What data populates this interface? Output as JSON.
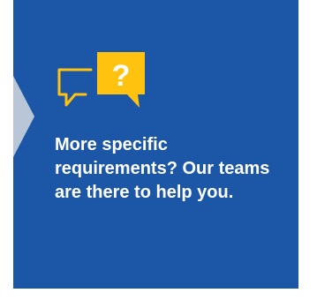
{
  "card": {
    "icon": "chat-question-icon",
    "message": "More specific requirements? Our teams are there to help you.",
    "icon_glyph": "?"
  },
  "colors": {
    "background": "#1c56a7",
    "accent": "#ffc20e",
    "arrow": "#b9c6d8",
    "text": "#ffffff"
  }
}
